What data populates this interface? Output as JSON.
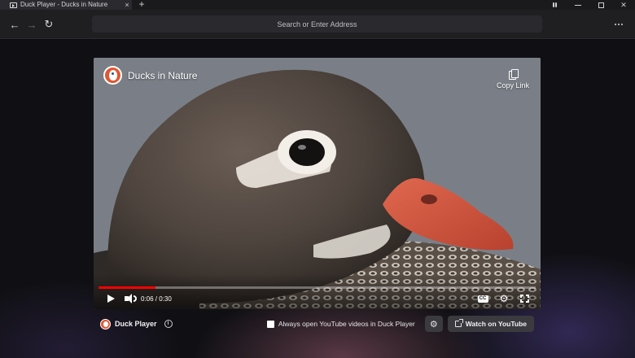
{
  "window": {
    "tab_title": "Duck Player - Ducks in Nature",
    "tab_favicon": "video-play-icon",
    "new_tab_label": "+",
    "tab_close_label": "×",
    "controls": [
      "fire-icon",
      "minimize-icon",
      "maximize-icon",
      "close-icon"
    ],
    "close_label": "✕"
  },
  "toolbar": {
    "back_label": "←",
    "forward_label": "→",
    "reload_label": "↻",
    "address_placeholder": "Search or Enter Address",
    "menu_icon": "more-horizontal-icon"
  },
  "player": {
    "channel_title": "Ducks in Nature",
    "copy_link_label": "Copy Link",
    "time_display": "0:06 / 0:30",
    "progress": 0.13,
    "colors": {
      "progress_fill": "#ff0000",
      "channel_logo": "#de5833"
    }
  },
  "duck_player_bar": {
    "brand_label": "Duck Player",
    "info_label": "i",
    "always_open_label": "Always open YouTube videos in Duck Player",
    "always_open_checked": false,
    "settings_icon": "gear-icon",
    "watch_on_youtube_label": "Watch on YouTube"
  }
}
